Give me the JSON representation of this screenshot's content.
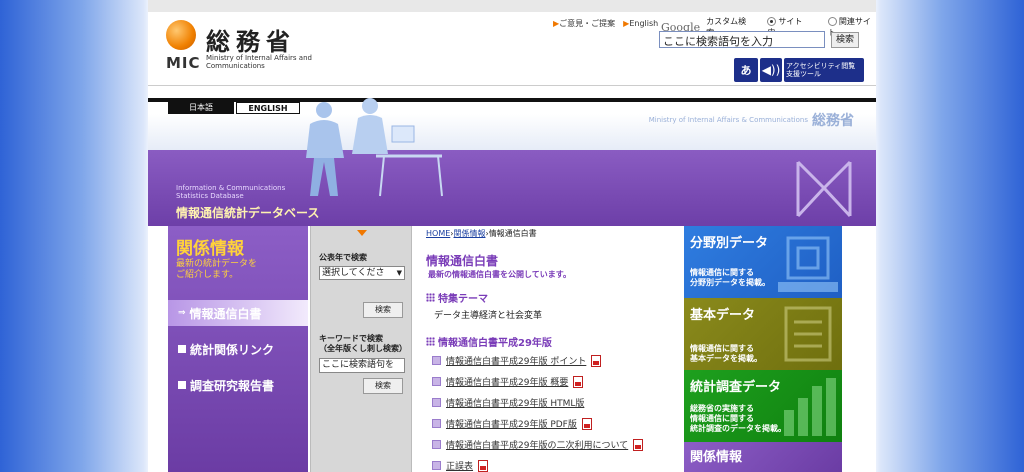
{
  "header": {
    "logo_text_jp": "総務省",
    "logo_text_mic": "MIC",
    "logo_text_en": "Ministry of Internal Affairs and Communications",
    "links": [
      {
        "label": "ご意見・ご提案"
      },
      {
        "label": "English"
      }
    ],
    "search": {
      "google_label": "Google",
      "custom_label": "カスタム検索",
      "option_site": "サイト内",
      "option_related": "関連サイト",
      "input_value": "ここに検索語句を入力",
      "button_label": "検索"
    },
    "accessibility": {
      "font_label": "あ",
      "voice_label": "アクセシビリティ閲覧支援ツール"
    }
  },
  "lang": {
    "jp": "日本語",
    "en": "ENGLISH"
  },
  "banner": {
    "brand_en": "Ministry of Internal Affairs  & Communications",
    "brand_jp": "総務省",
    "title_en_1": "Information & Communications",
    "title_en_2": "Statistics Database",
    "title_jp": "情報通信統計データベース"
  },
  "leftnav": {
    "title": "関係情報",
    "subtitle_1": "最新の統計データを",
    "subtitle_2": "ご紹介します。",
    "items": [
      {
        "label": "情報通信白書"
      },
      {
        "label": "統計関係リンク"
      },
      {
        "label": "調査研究報告書"
      }
    ]
  },
  "searchcol": {
    "year_label": "公表年で検索",
    "select_value": "選択してくださ",
    "button_label": "検索",
    "keyword_label_1": "キーワードで検索",
    "keyword_label_2": "（全年版くし刺し検索）",
    "keyword_value": "ここに検索語句を"
  },
  "main": {
    "breadcrumb_home": "HOME",
    "breadcrumb_mid": "関係情報",
    "breadcrumb_current": "情報通信白書",
    "title": "情報通信白書",
    "subtitle": "最新の情報通信白書を公開しています。",
    "section1_title": "特集テーマ",
    "section1_text": "データ主導経済と社会変革",
    "section2_title": "情報通信白書平成29年版",
    "links": [
      {
        "label": "情報通信白書平成29年版 ポイント",
        "pdf": true
      },
      {
        "label": "情報通信白書平成29年版 概要",
        "pdf": true
      },
      {
        "label": "情報通信白書平成29年版 HTML版",
        "pdf": false
      },
      {
        "label": "情報通信白書平成29年版 PDF版",
        "pdf": true
      },
      {
        "label": "情報通信白書平成29年版の二次利用について",
        "pdf": true
      },
      {
        "label": "正誤表",
        "pdf": true
      }
    ]
  },
  "tiles": [
    {
      "title": "分野別データ",
      "desc_1": "情報通信に関する",
      "desc_2": "分野別データを掲載。",
      "color": "#2f7de0"
    },
    {
      "title": "基本データ",
      "desc_1": "情報通信に関する",
      "desc_2": "基本データを掲載。",
      "color": "#8a8a1c"
    },
    {
      "title": "統計調査データ",
      "desc_1": "総務省の実施する",
      "desc_2": "情報通信に関する",
      "desc_3": "統計調査のデータを掲載。",
      "color": "#1ea01e"
    },
    {
      "title": "関係情報",
      "color": "#8c5ec6"
    }
  ]
}
